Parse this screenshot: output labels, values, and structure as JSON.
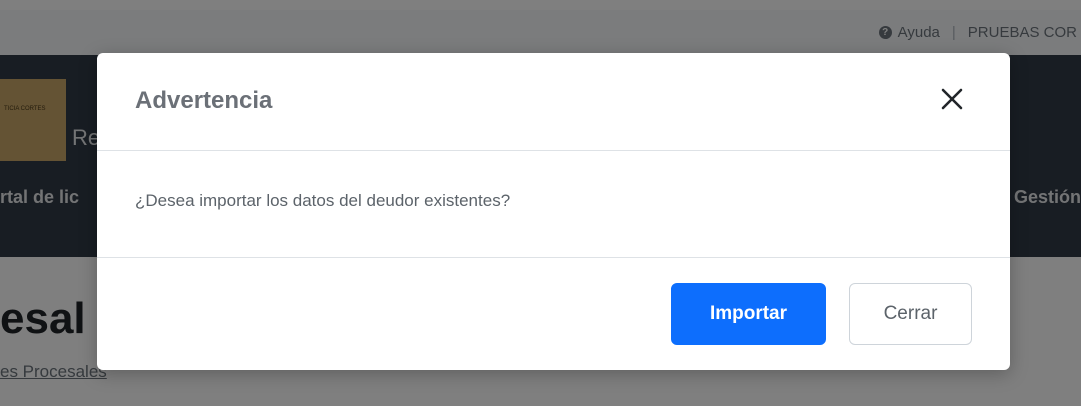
{
  "topbar": {
    "help_label": "Ayuda",
    "separator": "|",
    "user_label": "PRUEBAS COR"
  },
  "brand": {
    "logo_text": "TICIA CORTES",
    "title_fragment": "Re"
  },
  "nav": {
    "left_fragment": "rtal de lic",
    "right_fragment": "Gestión"
  },
  "page": {
    "heading_fragment": "esal",
    "link_fragment": "es Procesales"
  },
  "modal": {
    "title": "Advertencia",
    "close_icon": "close-icon",
    "message": "¿Desea importar los datos del deudor existentes?",
    "primary_button": "Importar",
    "secondary_button": "Cerrar"
  },
  "colors": {
    "primary": "#0d6efd",
    "backdrop": "rgba(0,0,0,0.5)",
    "header_bar": "#313a46"
  }
}
